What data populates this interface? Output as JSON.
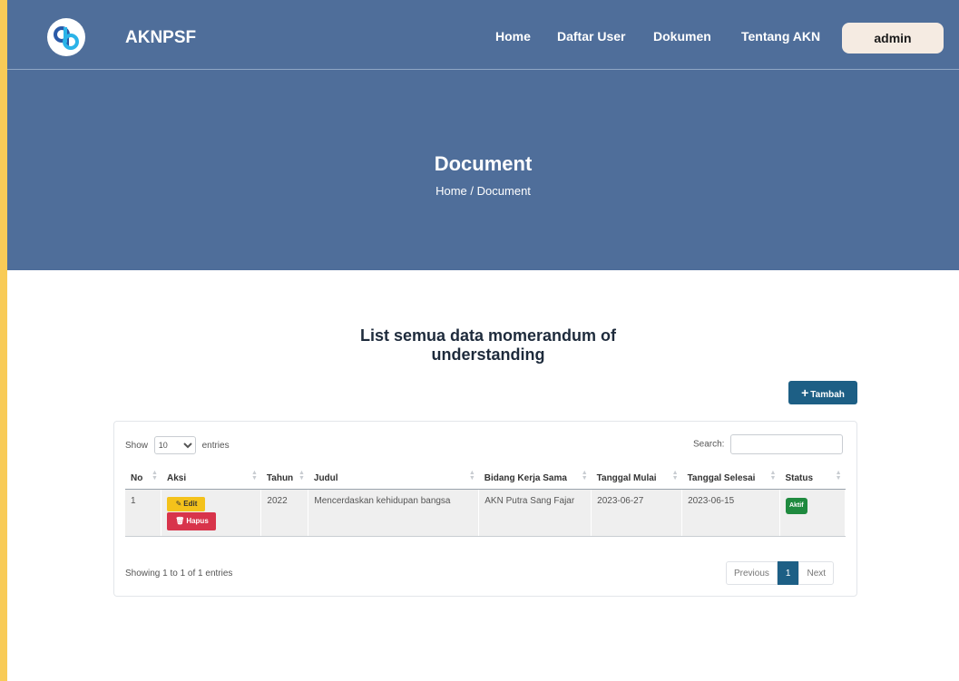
{
  "brand": {
    "name": "AKNPSF",
    "logo_text": "qb"
  },
  "nav": {
    "items": [
      {
        "label": "Home"
      },
      {
        "label": "Daftar User"
      },
      {
        "label": "Dokumen"
      },
      {
        "label": "Tentang AKN"
      }
    ],
    "user_button": "admin"
  },
  "hero": {
    "title": "Document",
    "breadcrumb": {
      "home": "Home",
      "separator": "/",
      "current": "Document"
    }
  },
  "main": {
    "title": "List semua data momerandum of understanding",
    "add_button": "Tambah"
  },
  "table": {
    "length": {
      "show": "Show",
      "selected": "10",
      "entries": "entries"
    },
    "search_label": "Search:",
    "columns": [
      "No",
      "Aksi",
      "Tahun",
      "Judul",
      "Bidang Kerja Sama",
      "Tanggal Mulai",
      "Tanggal Selesai",
      "Status"
    ],
    "rows": [
      {
        "no": "1",
        "edit": "Edit",
        "hapus": "Hapus",
        "tahun": "2022",
        "judul": "Mencerdaskan kehidupan bangsa",
        "bidang": "AKN Putra Sang Fajar",
        "mulai": "2023-06-27",
        "selesai": "2023-06-15",
        "status": "Aktif"
      }
    ],
    "info": "Showing 1 to 1 of 1 entries",
    "pagination": {
      "previous": "Previous",
      "page": "1",
      "next": "Next"
    }
  },
  "colors": {
    "navbar": "#4f6e9a",
    "primary_button": "#1d5f85",
    "edit_button": "#f4c21b",
    "delete_button": "#d8344b",
    "status_badge": "#1f8a3f",
    "border_frame": "#f8cb57"
  }
}
